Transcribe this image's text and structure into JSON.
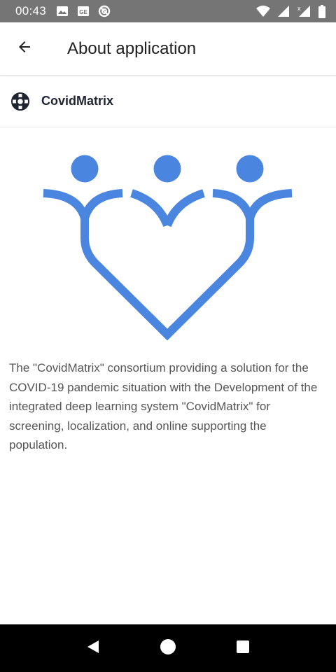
{
  "status_bar": {
    "time": "00:43",
    "left_icons": [
      "image-icon",
      "sim-card-icon",
      "blocked-icon"
    ],
    "right_icons": [
      "wifi-icon",
      "signal-icon",
      "signal-no-data-icon",
      "battery-icon"
    ]
  },
  "app_bar": {
    "title": "About application",
    "back_icon": "arrow-left-icon"
  },
  "app_row": {
    "icon": "lifebuoy-icon",
    "name": "CovidMatrix"
  },
  "logo": {
    "icon": "three-people-heart-logo",
    "color": "#4a86e0"
  },
  "description": "The \"CovidMatrix\" consortium providing a solution for the COVID-19 pandemic situation with the Development of the integrated deep learning system \"CovidMatrix\" for screening, localization, and online supporting the population.",
  "nav_bar": {
    "buttons": [
      "back-triangle-icon",
      "home-circle-icon",
      "recents-square-icon"
    ]
  },
  "colors": {
    "status_bar_bg": "#757575",
    "accent": "#4a86e0",
    "text_primary": "#212121",
    "text_secondary": "#555555"
  }
}
